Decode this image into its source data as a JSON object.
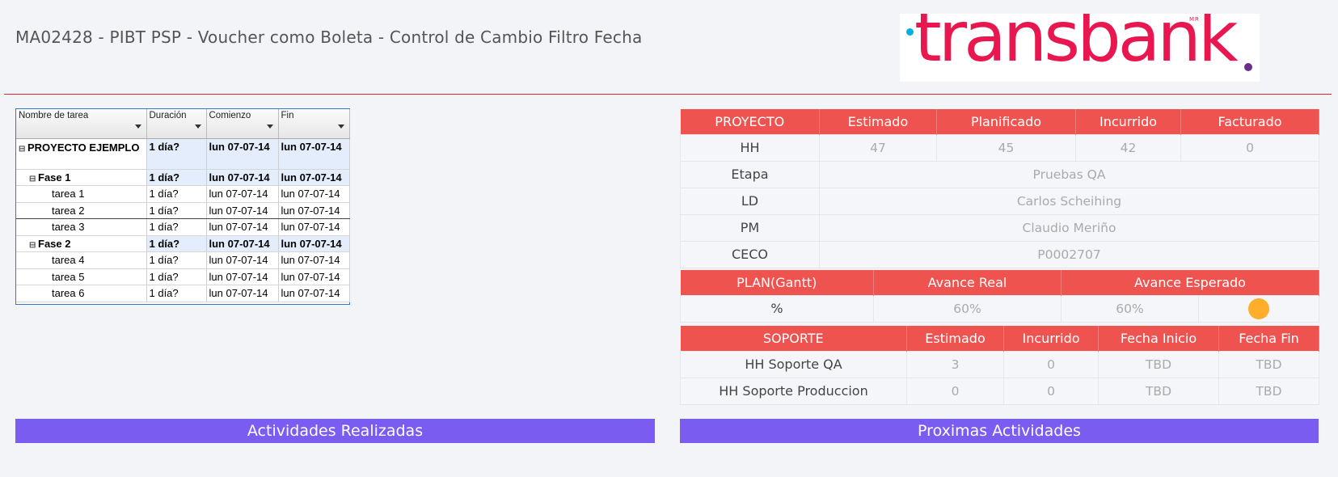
{
  "header": {
    "title": "MA02428 - PIBT PSP - Voucher como Boleta - Control de Cambio Filtro Fecha"
  },
  "logo": {
    "text": "transbank",
    "mark": "MR"
  },
  "gantt": {
    "columns": [
      "Nombre de tarea",
      "Duración",
      "Comienzo",
      "Fin"
    ],
    "rows": [
      {
        "name": "PROYECTO EJEMPLO",
        "duration": "1 día?",
        "start": "lun 07-07-14",
        "end": "lun 07-07-14"
      },
      {
        "name": "Fase 1",
        "duration": "1 día?",
        "start": "lun 07-07-14",
        "end": "lun 07-07-14"
      },
      {
        "name": "tarea 1",
        "duration": "1 día?",
        "start": "lun 07-07-14",
        "end": "lun 07-07-14"
      },
      {
        "name": "tarea 2",
        "duration": "1 día?",
        "start": "lun 07-07-14",
        "end": "lun 07-07-14"
      },
      {
        "name": "tarea 3",
        "duration": "1 día?",
        "start": "lun 07-07-14",
        "end": "lun 07-07-14"
      },
      {
        "name": "Fase 2",
        "duration": "1 día?",
        "start": "lun 07-07-14",
        "end": "lun 07-07-14"
      },
      {
        "name": "tarea 4",
        "duration": "1 día?",
        "start": "lun 07-07-14",
        "end": "lun 07-07-14"
      },
      {
        "name": "tarea 5",
        "duration": "1 día?",
        "start": "lun 07-07-14",
        "end": "lun 07-07-14"
      },
      {
        "name": "tarea 6",
        "duration": "1 día?",
        "start": "lun 07-07-14",
        "end": "lun 07-07-14"
      }
    ],
    "toggle_glyph": "⊟"
  },
  "project": {
    "headers": [
      "PROYECTO",
      "Estimado",
      "Planificado",
      "Incurrido",
      "Facturado"
    ],
    "hh": {
      "label": "HH",
      "values": [
        "47",
        "45",
        "42",
        "0"
      ]
    },
    "etapa": {
      "label": "Etapa",
      "value": "Pruebas QA"
    },
    "ld": {
      "label": "LD",
      "value": "Carlos Scheihing"
    },
    "pm": {
      "label": "PM",
      "value": "Claudio Meriño"
    },
    "ceco": {
      "label": "CECO",
      "value": "P0002707"
    }
  },
  "plan": {
    "headers": [
      "PLAN(Gantt)",
      "Avance Real",
      "Avance Esperado"
    ],
    "row": {
      "label": "%",
      "real": "60%",
      "expected": "60%"
    },
    "status_color": "#ffae2c"
  },
  "support": {
    "headers": [
      "SOPORTE",
      "Estimado",
      "Incurrido",
      "Fecha Inicio",
      "Fecha Fin"
    ],
    "rows": [
      {
        "label": "HH Soporte QA",
        "values": [
          "3",
          "0",
          "TBD",
          "TBD"
        ]
      },
      {
        "label": "HH Soporte Produccion",
        "values": [
          "0",
          "0",
          "TBD",
          "TBD"
        ]
      }
    ]
  },
  "sections": {
    "done": "Actividades Realizadas",
    "next": "Proximas Actividades"
  },
  "colors": {
    "accent_red": "#ef5350",
    "section_purple": "#7b5cf0",
    "brand": "#e8174f",
    "divider": "#d9262e"
  }
}
